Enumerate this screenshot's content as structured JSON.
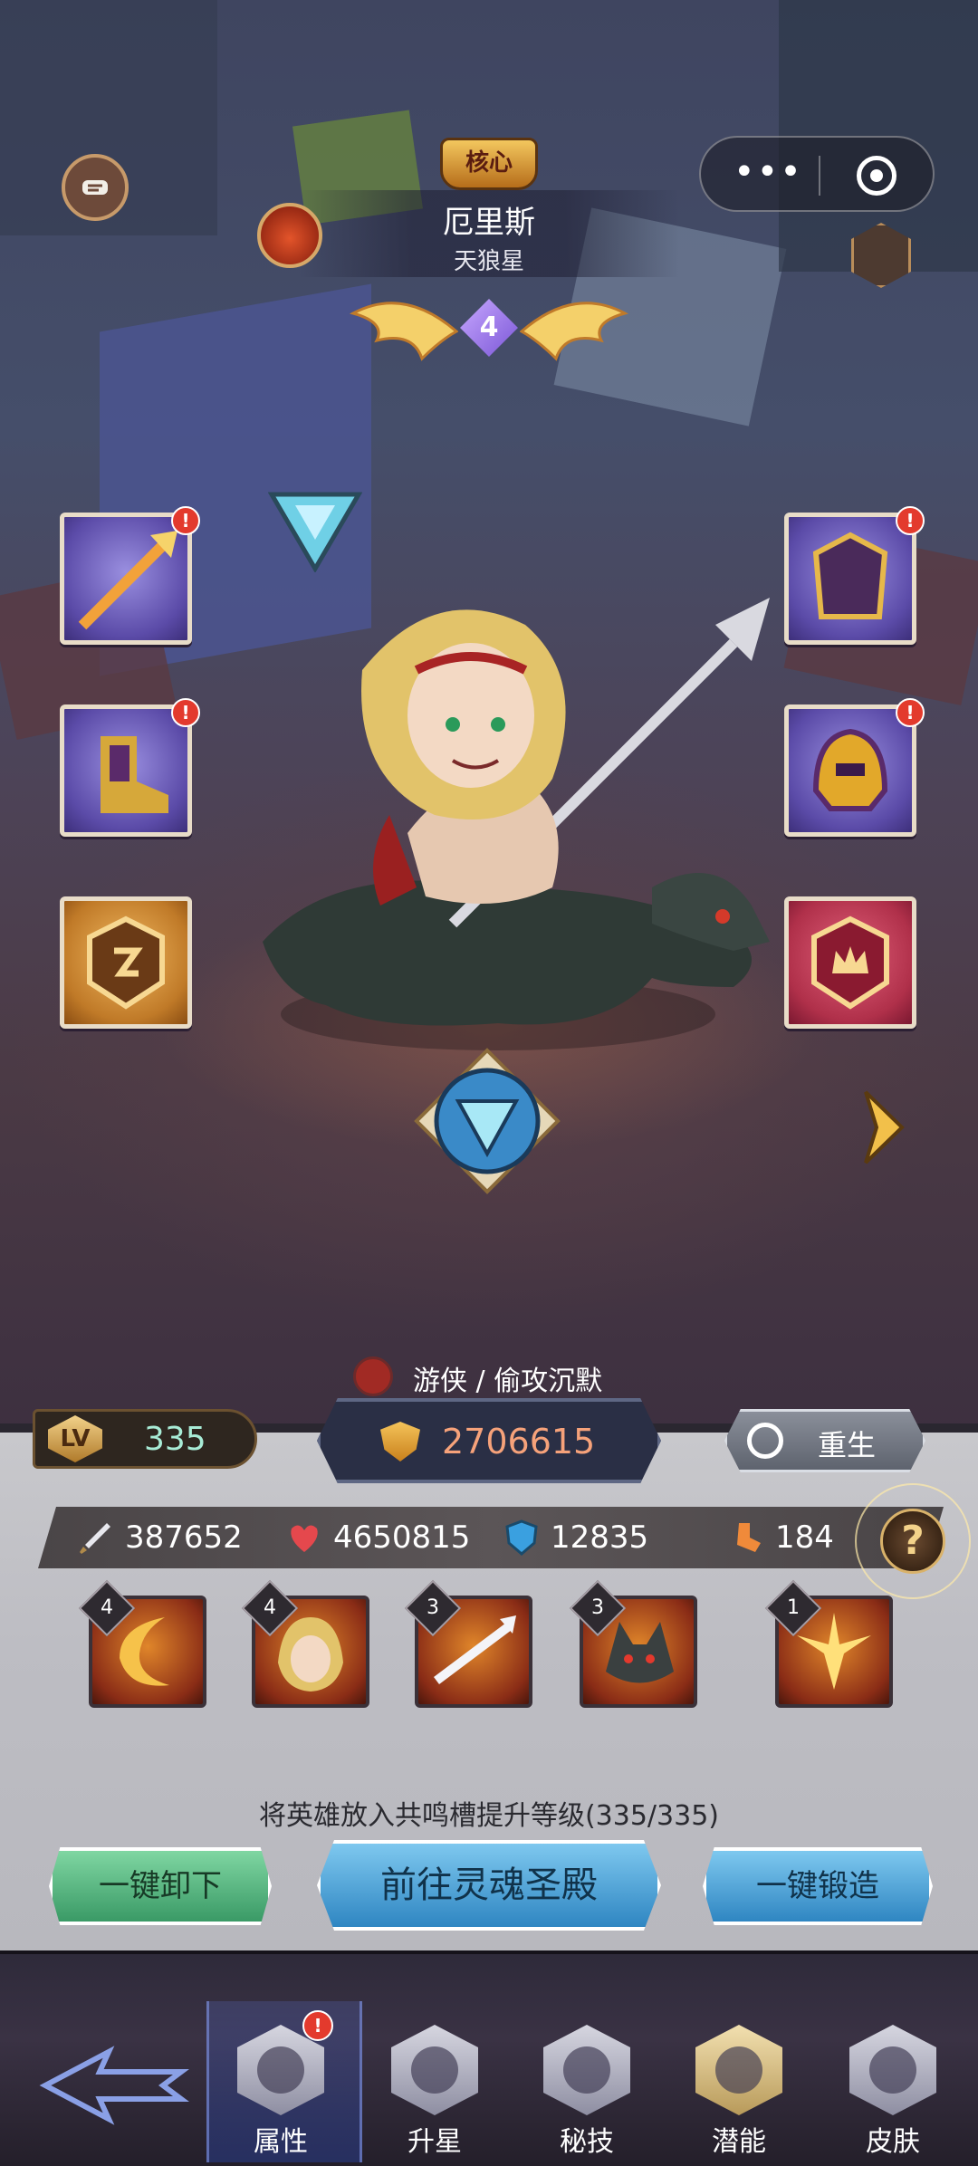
{
  "hero": {
    "core_label": "核心",
    "name": "厄里斯",
    "star_sign": "天狼星",
    "star_level": "4"
  },
  "class_tag": "游侠 / 偷攻沉默",
  "level": {
    "label": "LV",
    "value": "335"
  },
  "power": "2706615",
  "rebirth_label": "重生",
  "stats": {
    "attack": "387652",
    "hp": "4650815",
    "defense": "12835",
    "speed": "184"
  },
  "help_label": "?",
  "skills": [
    {
      "level": "4",
      "name": "skill-moon-icon"
    },
    {
      "level": "4",
      "name": "skill-hero-portrait-icon"
    },
    {
      "level": "3",
      "name": "skill-spear-icon"
    },
    {
      "level": "3",
      "name": "skill-wolf-icon"
    },
    {
      "level": "1",
      "name": "skill-burst-icon"
    }
  ],
  "resonate_text": "将英雄放入共鸣槽提升等级(335/335)",
  "buttons": {
    "unequip_all": "一键卸下",
    "soul_hall": "前往灵魂圣殿",
    "forge_all": "一键锻造"
  },
  "nav": [
    {
      "label": "属性",
      "active": true,
      "alert": "!"
    },
    {
      "label": "升星"
    },
    {
      "label": "秘技"
    },
    {
      "label": "潜能"
    },
    {
      "label": "皮肤"
    }
  ],
  "equipment_alert": "!",
  "colors": {
    "accent_red": "#e33a2d",
    "power_text": "#f6a27a",
    "level_text": "#a8ecd6",
    "button_green": "#3a9a66",
    "button_blue": "#2f86c2"
  }
}
